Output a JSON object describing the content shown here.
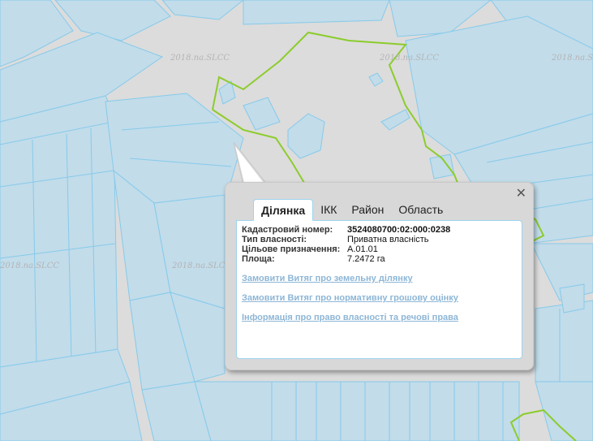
{
  "map": {
    "watermark": "2018.na.SLCC",
    "colors": {
      "background": "#dcdcdc",
      "parcel_fill": "#c2dcea",
      "parcel_line": "#86caea",
      "boundary": "#8ccc2c"
    }
  },
  "popup": {
    "close_icon": "✕",
    "tabs": [
      "Ділянка",
      "ІКК",
      "Район",
      "Область"
    ],
    "active_tab": "Ділянка",
    "fields": [
      {
        "label": "Кадастровий номер:",
        "value": "3524080700:02:000:0238"
      },
      {
        "label": "Тип власності:",
        "value": "Приватна власність"
      },
      {
        "label": "Цільове призначення:",
        "value": "A.01.01"
      },
      {
        "label": "Площа:",
        "value": "7.2472 га"
      }
    ],
    "links": [
      "Замовити Витяг про земельну ділянку",
      "Замовити Витяг про нормативну грошову оцінку",
      "Інформація про право власності та речові права"
    ]
  }
}
